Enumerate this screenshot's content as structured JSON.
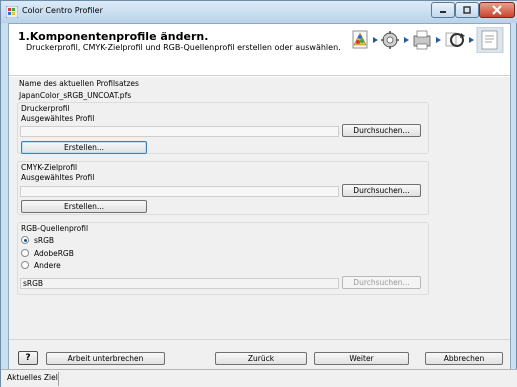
{
  "window": {
    "title": "Color Centro Profiler"
  },
  "header": {
    "title": "1.Komponentenprofile ändern.",
    "subtitle": "Druckerprofil, CMYK-Zielprofil und RGB-Quellenprofil erstellen oder auswählen.",
    "steps": [
      "profile-wizard-icon",
      "gear-icon",
      "printer-icon",
      "refresh-icon",
      "document-icon"
    ]
  },
  "profile_set": {
    "label": "Name des aktuellen Profilsatzes",
    "value": "JapanColor_sRGB_UNCOAT.pfs"
  },
  "printer_profile": {
    "group_label": "Druckerprofil",
    "selected_label": "Ausgewähltes Profil",
    "value": "",
    "browse_label": "Durchsuchen...",
    "create_label": "Erstellen..."
  },
  "cmyk_profile": {
    "group_label": "CMYK-Zielprofil",
    "selected_label": "Ausgewähltes Profil",
    "value": "",
    "browse_label": "Durchsuchen...",
    "create_label": "Erstellen..."
  },
  "rgb_profile": {
    "group_label": "RGB-Quellenprofil",
    "options": [
      "sRGB",
      "AdobeRGB",
      "Andere"
    ],
    "selected": "sRGB",
    "value": "sRGB",
    "browse_label": "Durchsuchen..."
  },
  "footer": {
    "help_label": "?",
    "pause_label": "Arbeit unterbrechen",
    "back_label": "Zurück",
    "next_label": "Weiter",
    "cancel_label": "Abbrechen"
  },
  "status": {
    "text": "Aktuelles Ziel"
  }
}
